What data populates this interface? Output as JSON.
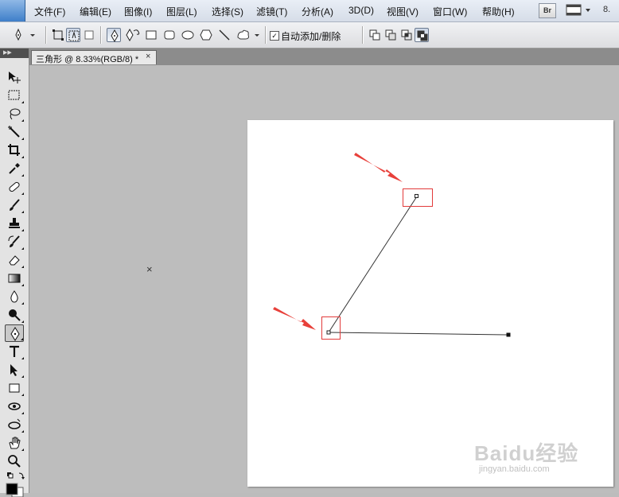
{
  "menubar": {
    "items": [
      "文件(F)",
      "编辑(E)",
      "图像(I)",
      "图层(L)",
      "选择(S)",
      "滤镜(T)",
      "分析(A)",
      "3D(D)",
      "视图(V)",
      "窗口(W)",
      "帮助(H)"
    ],
    "bridge_label": "Br",
    "zoom_partial": "8."
  },
  "options": {
    "auto_add_delete_label": "自动添加/删除",
    "auto_add_delete_checked": "✓"
  },
  "document": {
    "tab_title": "三角形 @ 8.33%(RGB/8) *",
    "close_glyph": "×"
  },
  "canvas": {
    "cursor_glyph": "×"
  },
  "watermark": {
    "logo": "Baidu经验",
    "url": "jingyan.baidu.com"
  },
  "colors": {
    "arrow": "#e8403a",
    "highlight_box": "#e23a3a",
    "path_stroke": "#333333"
  }
}
